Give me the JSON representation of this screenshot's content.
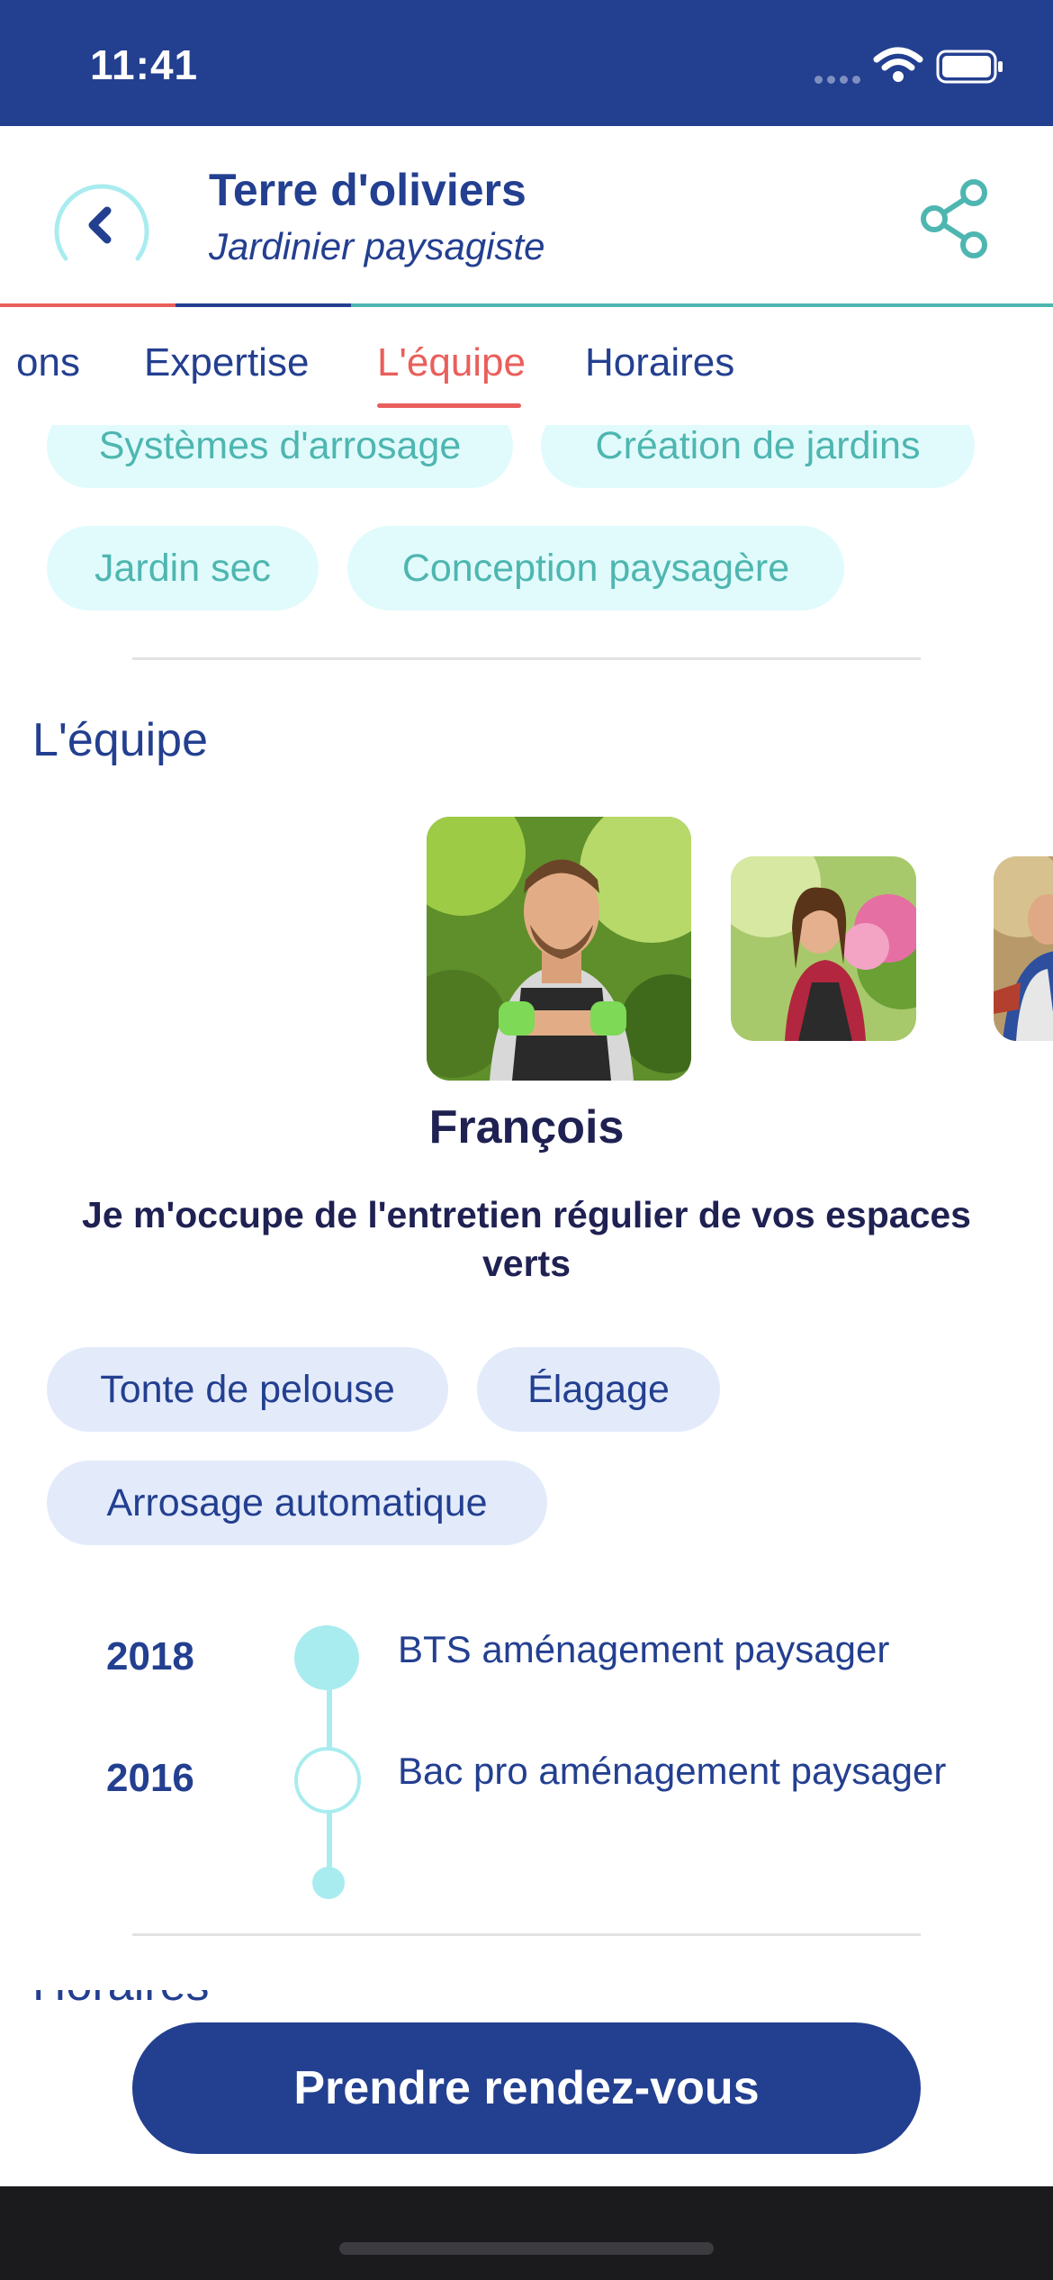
{
  "status_bar": {
    "time": "11:41"
  },
  "header": {
    "title": "Terre d'oliviers",
    "subtitle": "Jardinier paysagiste"
  },
  "tabs": [
    {
      "label": "ons",
      "active": false
    },
    {
      "label": "Expertise",
      "active": false
    },
    {
      "label": "L'équipe",
      "active": true
    },
    {
      "label": "Horaires",
      "active": false
    }
  ],
  "expertise_tags": [
    "Systèmes d'arrosage",
    "Création de jardins",
    "Jardin sec",
    "Conception paysagère"
  ],
  "team": {
    "section_title": "L'équipe",
    "selected_member": {
      "name": "François",
      "description": "Je m'occupe de l'entretien régulier de  vos espaces verts",
      "skills": [
        "Tonte de pelouse",
        "Élagage",
        "Arrosage automatique"
      ],
      "timeline": [
        {
          "year": "2018",
          "label": "BTS aménagement paysager"
        },
        {
          "year": "2016",
          "label": "Bac pro aménagement paysager"
        }
      ]
    }
  },
  "next_section_title_partial": "Horaires",
  "cta": {
    "label": "Prendre rendez-vous"
  },
  "colors": {
    "brand_blue": "#233f90",
    "accent_red": "#e95f5b",
    "teal": "#4eb6b0",
    "teal_light": "#a9ecf0"
  }
}
